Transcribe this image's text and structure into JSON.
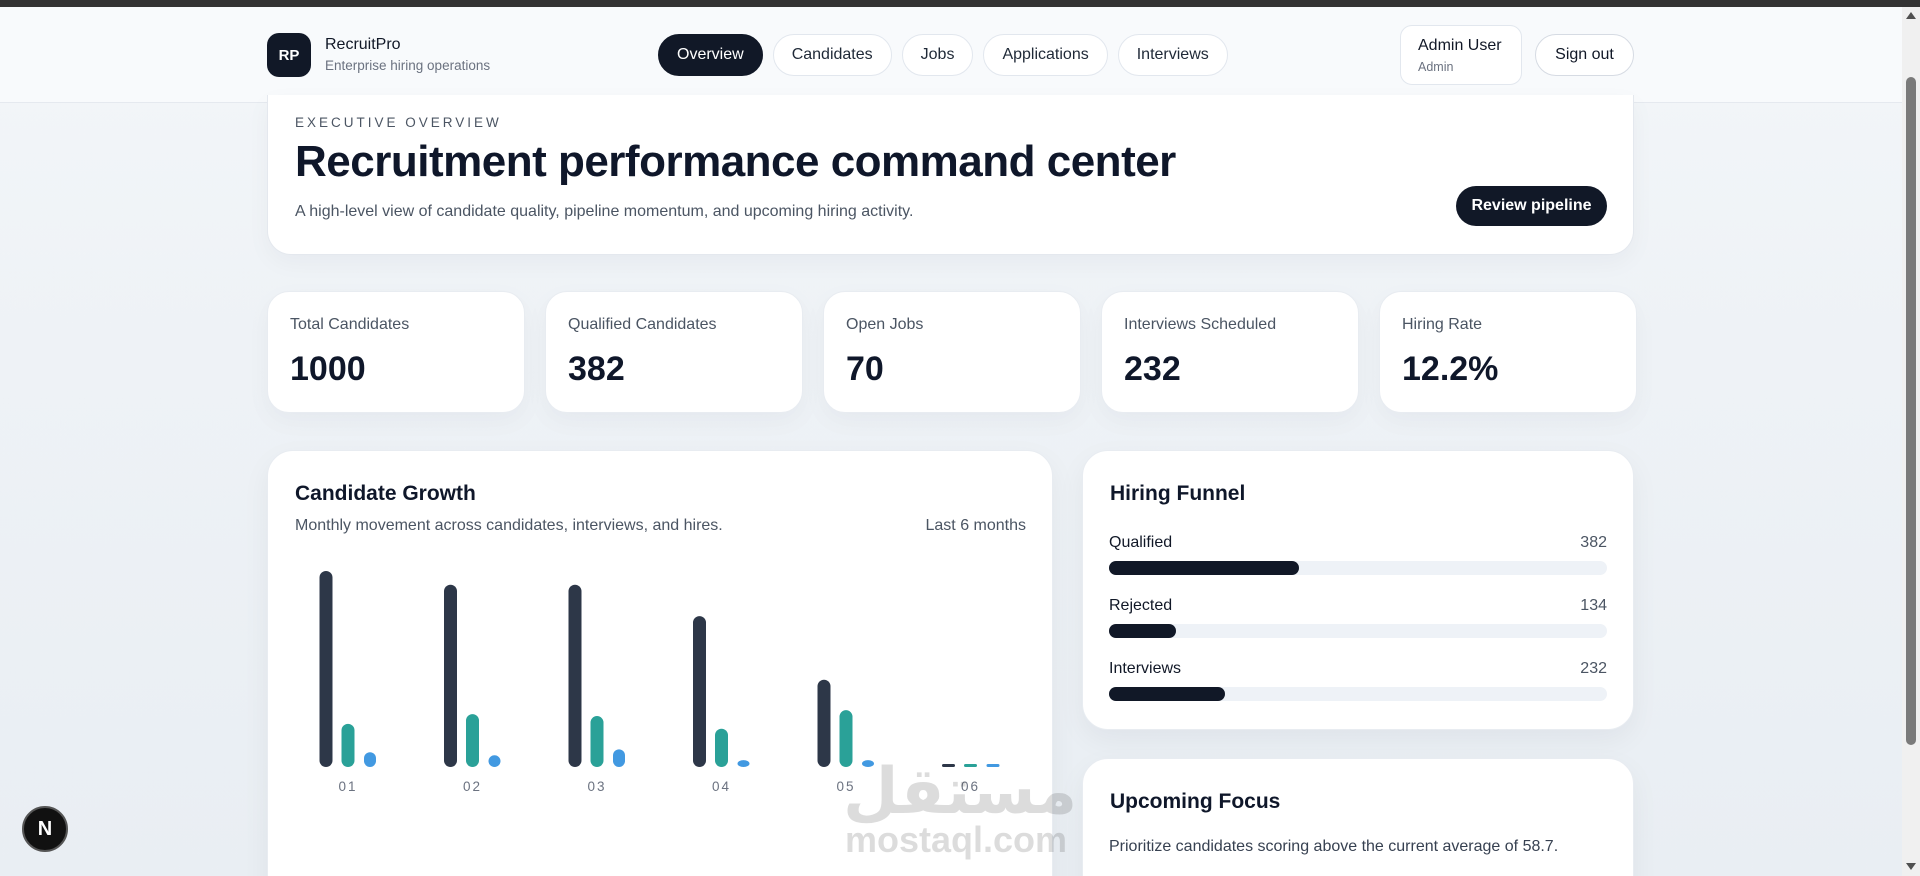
{
  "brand": {
    "initials": "RP",
    "name": "RecruitPro",
    "tagline": "Enterprise hiring operations"
  },
  "nav": [
    {
      "label": "Overview",
      "active": true
    },
    {
      "label": "Candidates",
      "active": false
    },
    {
      "label": "Jobs",
      "active": false
    },
    {
      "label": "Applications",
      "active": false
    },
    {
      "label": "Interviews",
      "active": false
    }
  ],
  "user": {
    "name": "Admin User",
    "role": "Admin",
    "signout_label": "Sign out"
  },
  "hero": {
    "eyebrow": "EXECUTIVE OVERVIEW",
    "title": "Recruitment performance command center",
    "description": "A high-level view of candidate quality, pipeline momentum, and upcoming hiring activity.",
    "button_label": "Review pipeline"
  },
  "kpis": [
    {
      "label": "Total Candidates",
      "value": "1000"
    },
    {
      "label": "Qualified Candidates",
      "value": "382"
    },
    {
      "label": "Open Jobs",
      "value": "70"
    },
    {
      "label": "Interviews Scheduled",
      "value": "232"
    },
    {
      "label": "Hiring Rate",
      "value": "12.2%"
    }
  ],
  "growth": {
    "title": "Candidate Growth",
    "subtitle": "Monthly movement across candidates, interviews, and hires.",
    "range": "Last 6 months"
  },
  "chart_data": {
    "type": "bar",
    "categories": [
      "01",
      "02",
      "03",
      "04",
      "05",
      "06"
    ],
    "series": [
      {
        "values": [
          200,
          186,
          186,
          154,
          89,
          0
        ],
        "color": "#2d3748"
      },
      {
        "values": [
          44,
          54,
          52,
          39,
          58,
          0
        ],
        "color": "#2aa198"
      },
      {
        "values": [
          15,
          12,
          18,
          7,
          7,
          0
        ],
        "color": "#4299e1"
      }
    ]
  },
  "funnel": {
    "title": "Hiring Funnel",
    "items": [
      {
        "label": "Qualified",
        "value": "382",
        "fraction": 0.382
      },
      {
        "label": "Rejected",
        "value": "134",
        "fraction": 0.134
      },
      {
        "label": "Interviews",
        "value": "232",
        "fraction": 0.232
      }
    ]
  },
  "focus": {
    "title": "Upcoming Focus",
    "text": "Prioritize candidates scoring above the current average of 58.7."
  },
  "overlay": {
    "badge": "N",
    "watermark_arabic": "مستقل",
    "watermark_latin": "mostaql.com"
  }
}
